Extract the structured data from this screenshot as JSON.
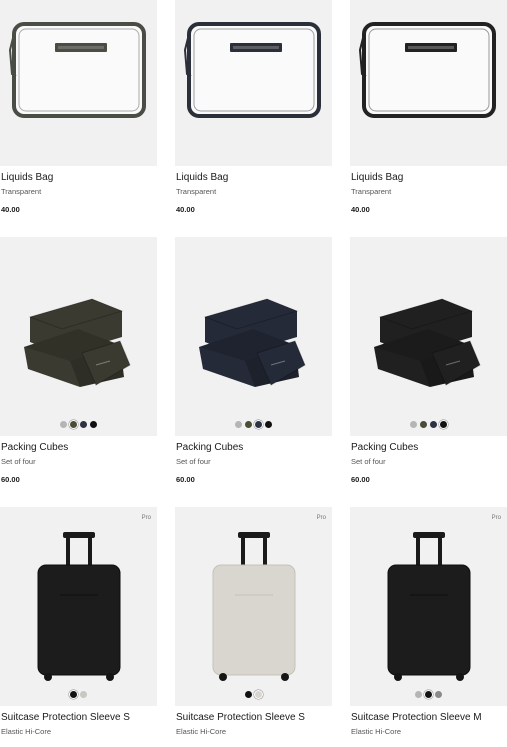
{
  "products": [
    {
      "name": "Liquids Bag",
      "variant": "Transparent",
      "price": "40.00",
      "badge": "",
      "frame_color": "#4a4d44",
      "swatches": []
    },
    {
      "name": "Liquids Bag",
      "variant": "Transparent",
      "price": "40.00",
      "badge": "",
      "frame_color": "#2b2f3a",
      "swatches": []
    },
    {
      "name": "Liquids Bag",
      "variant": "Transparent",
      "price": "40.00",
      "badge": "",
      "frame_color": "#222222",
      "swatches": []
    },
    {
      "name": "Packing Cubes",
      "variant": "Set of four",
      "price": "60.00",
      "badge": "",
      "frame_color": "#3b3a30",
      "swatches": [
        {
          "color": "#b5b5b5",
          "selected": false
        },
        {
          "color": "#4b4d36",
          "selected": true
        },
        {
          "color": "#2c3444",
          "selected": false
        },
        {
          "color": "#111111",
          "selected": false
        }
      ]
    },
    {
      "name": "Packing Cubes",
      "variant": "Set of four",
      "price": "60.00",
      "badge": "",
      "frame_color": "#242a38",
      "swatches": [
        {
          "color": "#b5b5b5",
          "selected": false
        },
        {
          "color": "#4b4d36",
          "selected": false
        },
        {
          "color": "#2c3444",
          "selected": true
        },
        {
          "color": "#111111",
          "selected": false
        }
      ]
    },
    {
      "name": "Packing Cubes",
      "variant": "Set of four",
      "price": "60.00",
      "badge": "",
      "frame_color": "#202020",
      "swatches": [
        {
          "color": "#b5b5b5",
          "selected": false
        },
        {
          "color": "#4b4d36",
          "selected": false
        },
        {
          "color": "#2c3444",
          "selected": false
        },
        {
          "color": "#111111",
          "selected": true
        }
      ]
    },
    {
      "name": "Suitcase Protection Sleeve S",
      "variant": "Elastic Hi-Core",
      "price": "",
      "badge": "Pro",
      "frame_color": "#1c1c1c",
      "swatches": [
        {
          "color": "#111111",
          "selected": true
        },
        {
          "color": "#c9c7c1",
          "selected": false
        }
      ]
    },
    {
      "name": "Suitcase Protection Sleeve S",
      "variant": "Elastic Hi-Core",
      "price": "",
      "badge": "Pro",
      "frame_color": "#d9d6cf",
      "swatches": [
        {
          "color": "#111111",
          "selected": false
        },
        {
          "color": "#d9d6cf",
          "selected": true
        }
      ]
    },
    {
      "name": "Suitcase Protection Sleeve M",
      "variant": "Elastic Hi-Core",
      "price": "",
      "badge": "Pro",
      "frame_color": "#1c1c1c",
      "swatches": [
        {
          "color": "#b5b5b5",
          "selected": false
        },
        {
          "color": "#111111",
          "selected": true
        },
        {
          "color": "#8a8a8a",
          "selected": false
        }
      ]
    }
  ]
}
